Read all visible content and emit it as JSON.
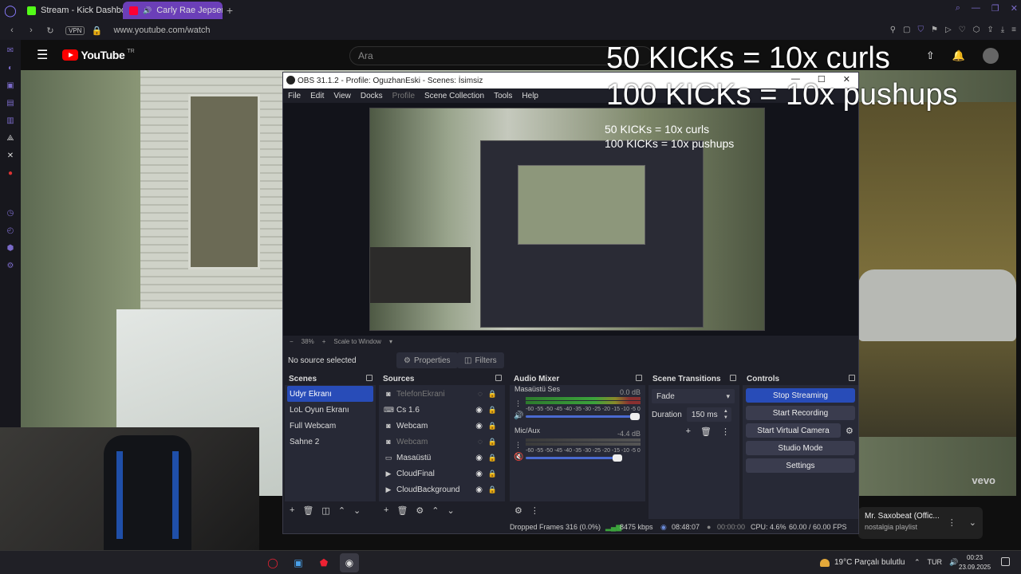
{
  "browser": {
    "tabs": [
      {
        "label": "Stream - Kick Dashboard",
        "color": "#53fc18"
      },
      {
        "label": "Carly Rae Jepsen - Ca",
        "color": "#ff0033"
      }
    ],
    "url": "www.youtube.com/watch",
    "vpn": "VPN"
  },
  "youtube": {
    "brand": "YouTube",
    "region": "TR",
    "search_placeholder": "Ara",
    "watermark": "vevo",
    "mini_title": "Mr. Saxobeat (Offic...",
    "mini_sub": "nostalgia playlist"
  },
  "overlay": {
    "line1": "50 KICKs = 10x curls",
    "line2": "100 KICKs = 10x pushups"
  },
  "obs": {
    "title": "OBS 31.1.2 - Profile: OguzhanEski - Scenes: İsimsiz",
    "menu": [
      "File",
      "Edit",
      "View",
      "Docks",
      "Profile",
      "Scene Collection",
      "Tools",
      "Help"
    ],
    "zoom": "38%",
    "scale_mode": "Scale to Window",
    "no_source": "No source selected",
    "properties": "Properties",
    "filters": "Filters",
    "docks": {
      "scenes": "Scenes",
      "sources": "Sources",
      "mixer": "Audio Mixer",
      "transitions": "Scene Transitions",
      "controls": "Controls"
    },
    "scenes": [
      "Udyr Ekranı",
      "LoL Oyun Ekranı",
      "Full Webcam",
      "Sahne 2"
    ],
    "sources": [
      {
        "name": "TelefonEkrani",
        "icon": "camera",
        "visible": false
      },
      {
        "name": "Cs 1.6",
        "icon": "gamepad",
        "visible": true
      },
      {
        "name": "Webcam",
        "icon": "camera",
        "visible": true
      },
      {
        "name": "Webcam",
        "icon": "camera",
        "visible": false
      },
      {
        "name": "Masaüstü",
        "icon": "monitor",
        "visible": true
      },
      {
        "name": "CloudFinal",
        "icon": "play",
        "visible": true
      },
      {
        "name": "CloudBackground",
        "icon": "play",
        "visible": true
      }
    ],
    "mixer": [
      {
        "name": "Masaüstü Ses",
        "db": "0.0 dB",
        "level": 0.95
      },
      {
        "name": "Mic/Aux",
        "db": "-4.4 dB",
        "level": 0.8
      }
    ],
    "meter_scale": [
      "-60",
      "-55",
      "-50",
      "-45",
      "-40",
      "-35",
      "-30",
      "-25",
      "-20",
      "-15",
      "-10",
      "-5",
      "0"
    ],
    "transition": "Fade",
    "duration_label": "Duration",
    "duration": "150 ms",
    "controls": {
      "stop_streaming": "Stop Streaming",
      "start_recording": "Start Recording",
      "start_virtual_camera": "Start Virtual Camera",
      "studio_mode": "Studio Mode",
      "settings": "Settings"
    },
    "status": {
      "dropped": "Dropped Frames 316 (0.0%)",
      "bitrate": "8475 kbps",
      "stream_time": "08:48:07",
      "rec_time": "00:00:00",
      "cpu": "CPU: 4.6%",
      "fps": "60.00 / 60.00 FPS"
    },
    "preview_text": {
      "line1": "50 KICKs = 10x curls",
      "line2": "100 KICKs = 10x pushups"
    }
  },
  "taskbar": {
    "weather": "19°C  Parçalı bulutlu",
    "lang": "TUR",
    "time": "00:23",
    "date": "23.09.2025"
  }
}
